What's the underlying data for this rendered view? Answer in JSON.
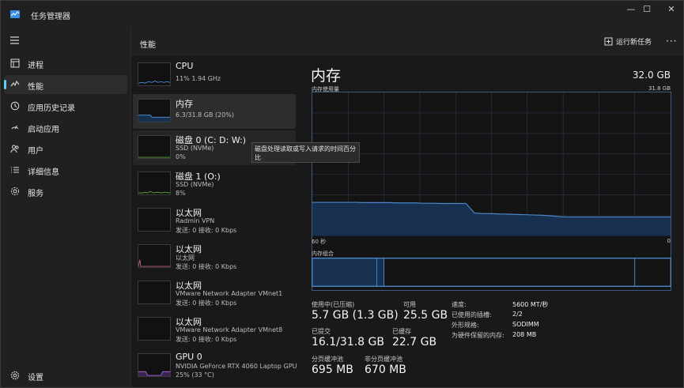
{
  "window": {
    "title": "任务管理器",
    "controls": {
      "minimize": "—",
      "maximize": "☐",
      "close": "✕"
    }
  },
  "sidebar": {
    "items": [
      {
        "label": "进程",
        "icon": "processes-icon"
      },
      {
        "label": "性能",
        "icon": "performance-icon"
      },
      {
        "label": "应用历史记录",
        "icon": "history-icon"
      },
      {
        "label": "启动应用",
        "icon": "startup-icon"
      },
      {
        "label": "用户",
        "icon": "users-icon"
      },
      {
        "label": "详细信息",
        "icon": "details-icon"
      },
      {
        "label": "服务",
        "icon": "services-icon"
      }
    ],
    "settings": "设置"
  },
  "header": {
    "title": "性能",
    "run_task": "运行新任务",
    "more": "···"
  },
  "devices": [
    {
      "name": "CPU",
      "sub1": "11%  1.94 GHz"
    },
    {
      "name": "内存",
      "sub1": "6.3/31.8 GB (20%)"
    },
    {
      "name": "磁盘 0 (C: D: W:)",
      "sub1": "SSD (NVMe)",
      "sub2": "0%"
    },
    {
      "name": "磁盘 1 (O:)",
      "sub1": "SSD (NVMe)",
      "sub2": "8%"
    },
    {
      "name": "以太网",
      "sub1": "Radmin VPN",
      "sub2": "发送: 0  接收: 0 Kbps"
    },
    {
      "name": "以太网",
      "sub1": "以太网",
      "sub2": "发送: 0  接收: 0 Kbps"
    },
    {
      "name": "以太网",
      "sub1": "VMware Network Adapter VMnet1",
      "sub2": "发送: 0  接收: 0 Kbps"
    },
    {
      "name": "以太网",
      "sub1": "VMware Network Adapter VMnet8",
      "sub2": "发送: 0  接收: 0 Kbps"
    },
    {
      "name": "GPU 0",
      "sub1": "NVIDIA GeForce RTX 4060 Laptop GPU",
      "sub2": "25% (33 °C)"
    }
  ],
  "tooltip": "磁盘处理读取或写入请求的时间百分比",
  "detail": {
    "title": "内存",
    "capacity": "32.0 GB",
    "usage_label": "内存使用量",
    "usage_max": "31.8 GB",
    "axis_left": "60 秒",
    "axis_right": "0",
    "composition_label": "内存组合",
    "stats": {
      "in_use_label": "使用中(已压缩)",
      "in_use_value": "5.7 GB (1.3 GB)",
      "available_label": "可用",
      "available_value": "25.5 GB",
      "committed_label": "已提交",
      "committed_value": "16.1/31.8 GB",
      "cached_label": "已缓存",
      "cached_value": "22.7 GB",
      "paged_label": "分页缓冲池",
      "paged_value": "695 MB",
      "nonpaged_label": "非分页缓冲池",
      "nonpaged_value": "670 MB"
    },
    "specs": [
      {
        "key": "速度:",
        "value": "5600 MT/秒"
      },
      {
        "key": "已使用的插槽:",
        "value": "2/2"
      },
      {
        "key": "外形规格:",
        "value": "SODIMM"
      },
      {
        "key": "为硬件保留的内存:",
        "value": "208 MB"
      }
    ],
    "memory_usage_history": [
      0.234,
      0.234,
      0.234,
      0.234,
      0.234,
      0.234,
      0.232,
      0.232,
      0.232,
      0.232,
      0.23,
      0.23,
      0.23,
      0.228,
      0.228,
      0.226,
      0.226,
      0.226,
      0.226,
      0.16,
      0.155,
      0.155,
      0.153,
      0.152,
      0.15,
      0.148,
      0.146,
      0.144,
      0.14,
      0.134,
      0.132,
      0.132,
      0.132,
      0.132,
      0.132,
      0.132,
      0.132,
      0.132,
      0.132,
      0.132,
      0.132,
      0.132,
      0.132
    ],
    "composition": {
      "in_use": 0.18,
      "modified": 0.02,
      "standby": 0.7,
      "free": 0.1
    }
  },
  "colors": {
    "accent": "#60cdff",
    "memory_line": "#4a86c8",
    "memory_fill": "#17304f",
    "disk_line": "#5fa33c",
    "net_line": "#c06080",
    "gpu_line": "#9c5fd0"
  }
}
